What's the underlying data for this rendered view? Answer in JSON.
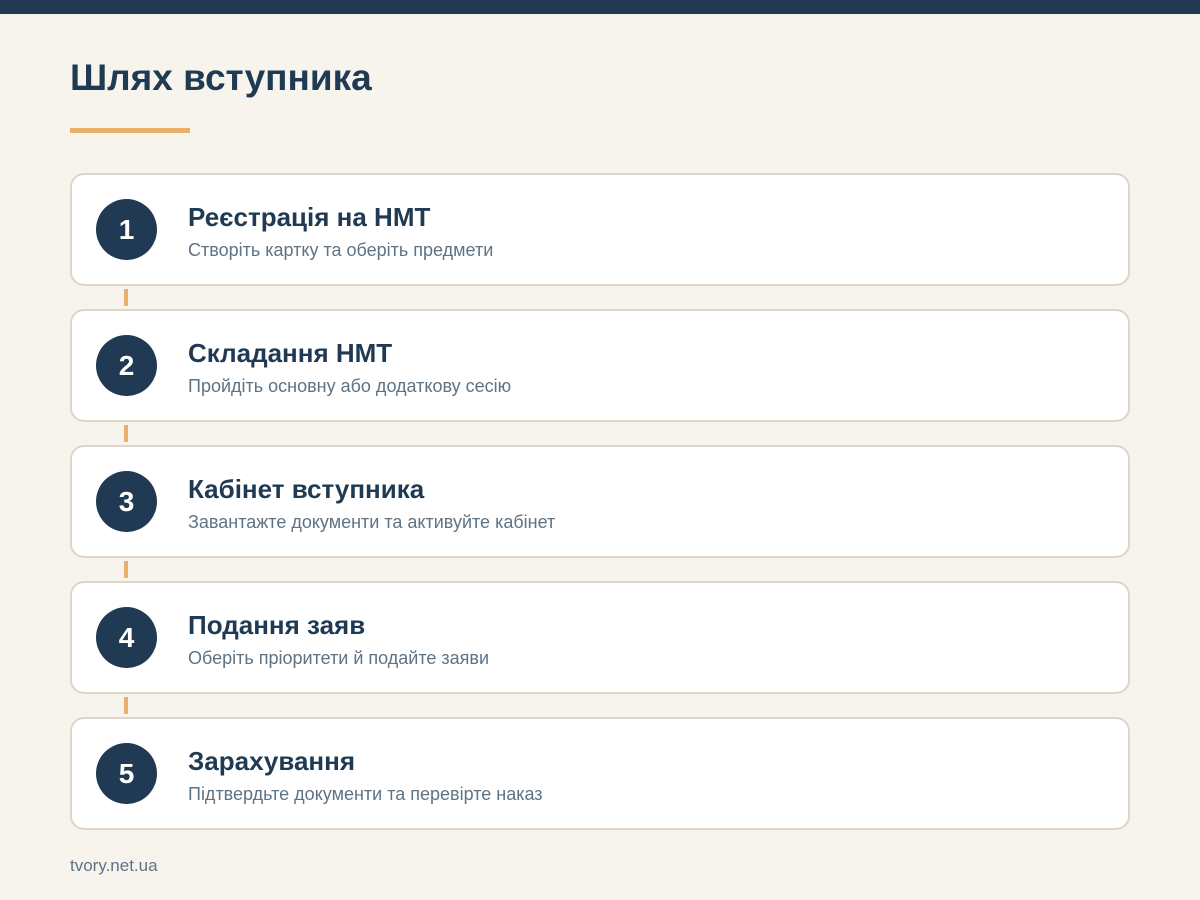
{
  "page": {
    "title": "Шлях вступника",
    "source": "tvory.net.ua"
  },
  "colors": {
    "primary": "#1f3a52",
    "accent": "#e8b06a",
    "background": "#f7f4ee",
    "card_border": "#ddd5c8",
    "muted_text": "#5e7384"
  },
  "steps": [
    {
      "number": "1",
      "title": "Реєстрація на НМТ",
      "description": "Створіть картку та оберіть предмети"
    },
    {
      "number": "2",
      "title": "Складання НМТ",
      "description": "Пройдіть основну або додаткову сесію"
    },
    {
      "number": "3",
      "title": "Кабінет вступника",
      "description": "Завантажте документи та активуйте кабінет"
    },
    {
      "number": "4",
      "title": "Подання заяв",
      "description": "Оберіть пріоритети й подайте заяви"
    },
    {
      "number": "5",
      "title": "Зарахування",
      "description": "Підтвердьте документи та перевірте наказ"
    }
  ]
}
